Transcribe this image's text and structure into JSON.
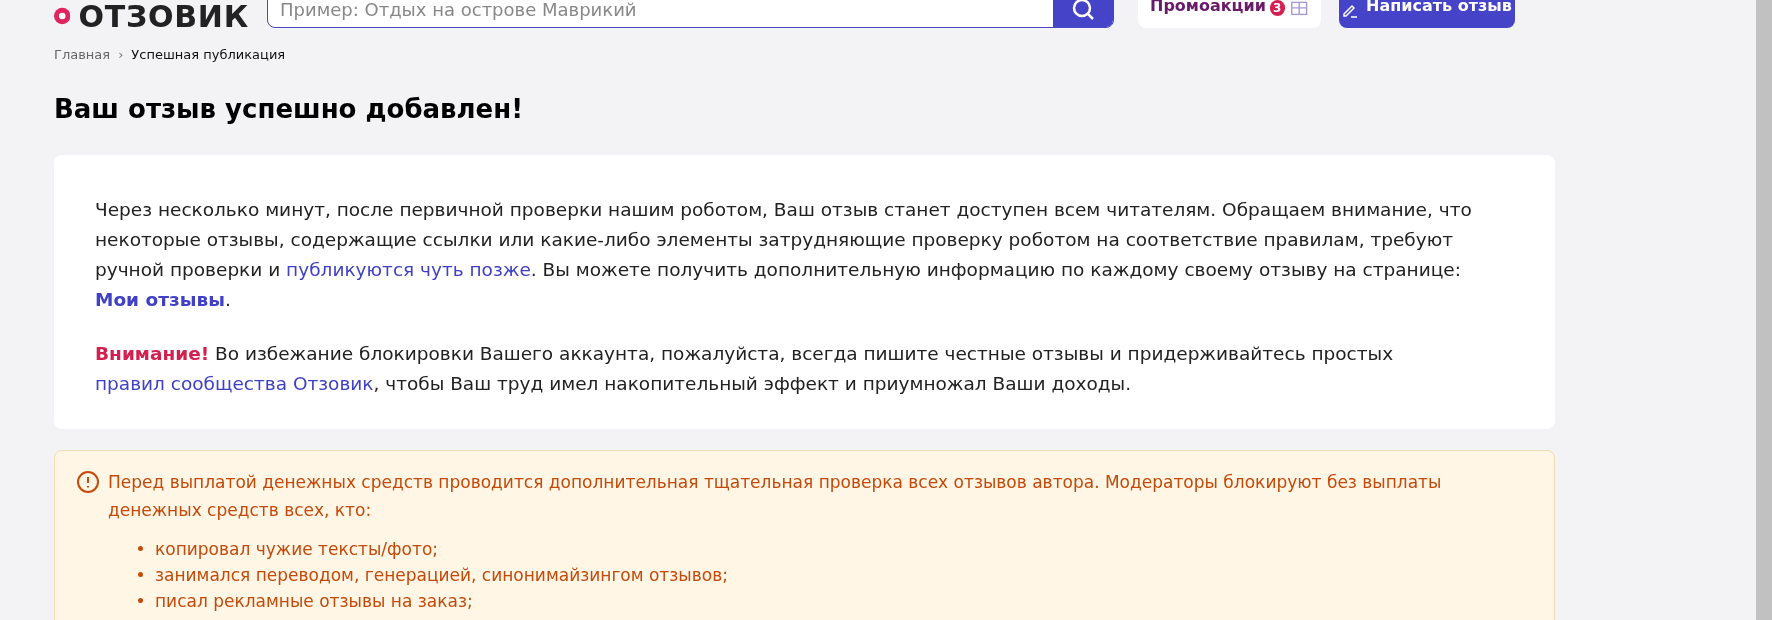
{
  "header": {
    "logo": "ОТЗОВИК",
    "search": {
      "placeholder": "Пример: Отдых на острове Маврикий"
    },
    "promo": {
      "label": "Промоакции",
      "count": "3"
    },
    "write_button": "Написать отзыв"
  },
  "breadcrumb_separator": "›",
  "breadcrumbs": [
    {
      "label": "Главная",
      "current": false
    },
    {
      "label": "Успешная публикация",
      "current": true
    }
  ],
  "title": "Ваш отзыв успешно добавлен!",
  "message": {
    "paragraphs": [
      [
        {
          "kind": "text",
          "text": "Через несколько минут, после первичной проверки нашим роботом, Ваш отзыв станет доступен всем читателям. Обращаем внимание, что некоторые отзывы, содержащие ссылки или какие-либо элементы затрудняющие проверку роботом на соответствие правилам, требуют ручной проверки и "
        },
        {
          "kind": "link",
          "text": "публикуются чуть позже"
        },
        {
          "kind": "text",
          "text": ". Вы можете получить дополнительную информацию по каждому своему отзыву на странице: "
        },
        {
          "kind": "strong_link",
          "text": "Мои отзывы"
        },
        {
          "kind": "text",
          "text": "."
        }
      ],
      [
        {
          "kind": "alert",
          "text": "Внимание!"
        },
        {
          "kind": "text",
          "text": " Во избежание блокировки Вашего аккаунта, пожалуйста, всегда пишите честные отзывы и придерживайтесь простых "
        },
        {
          "kind": "link",
          "text": "правил сообщества Отзовик"
        },
        {
          "kind": "text",
          "text": ", чтобы Ваш труд имел накопительный эффект и приумножал Ваши доходы."
        }
      ]
    ]
  },
  "warning": {
    "text": "Перед выплатой денежных средств проводится дополнительная тщательная проверка всех отзывов автора. Модераторы блокируют без выплаты денежных средств всех, кто:",
    "items": [
      "копировал чужие тексты/фото;",
      "занимался переводом, генерацией, синонимайзингом отзывов;",
      "писал рекламные отзывы на заказ;"
    ]
  }
}
